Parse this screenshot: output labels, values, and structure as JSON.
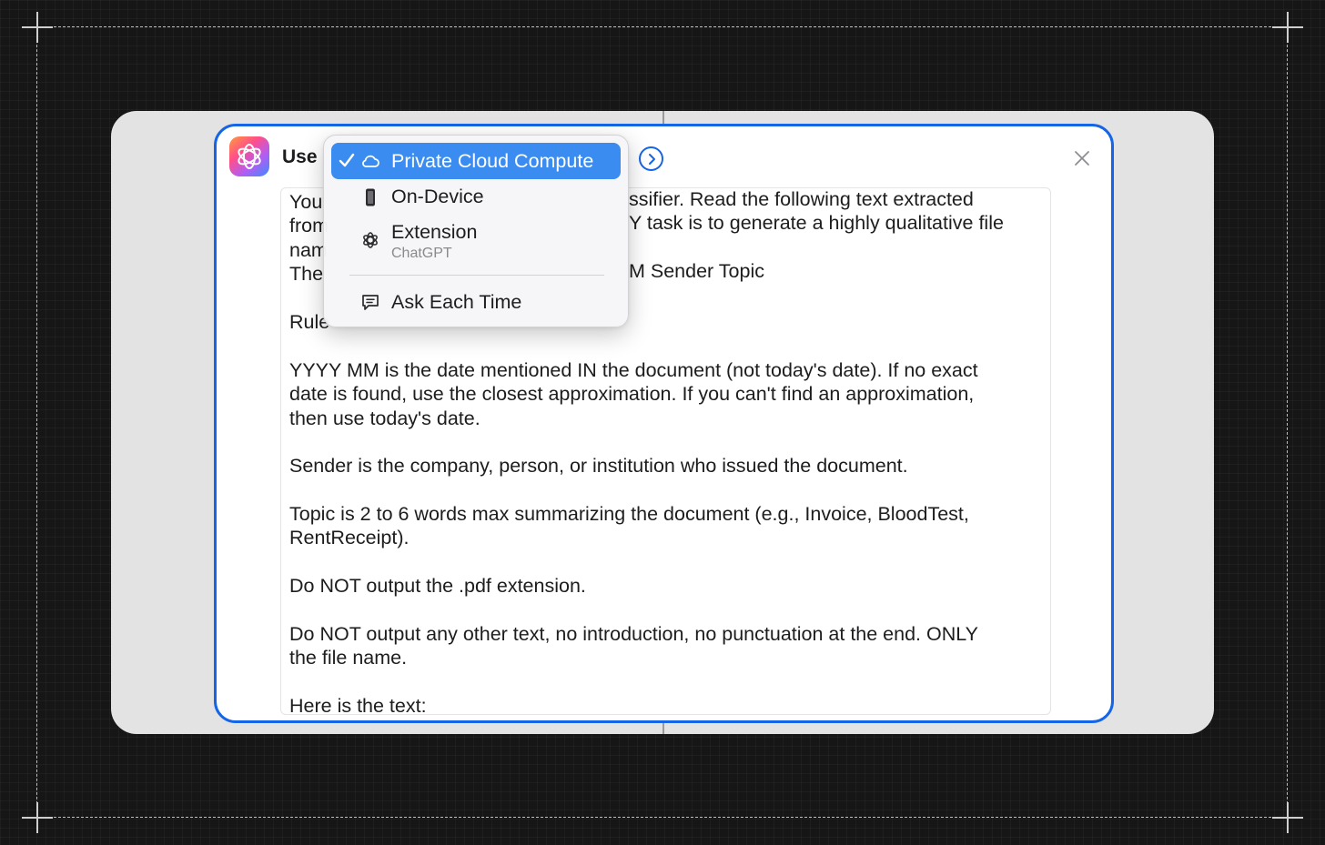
{
  "action": {
    "label": "Use",
    "app_icon": "apple-intelligence-icon"
  },
  "model_menu": {
    "items": [
      {
        "label": "Private Cloud Compute",
        "icon": "cloud-icon",
        "selected": true
      },
      {
        "label": "On-Device",
        "icon": "iphone-icon",
        "selected": false
      },
      {
        "label": "Extension",
        "sublabel": "ChatGPT",
        "icon": "chatgpt-icon",
        "selected": false
      },
      {
        "label": "Ask Each Time",
        "icon": "chat-bubble-icon",
        "selected": false
      }
    ]
  },
  "prompt": {
    "lines": [
      "You",
      "from",
      "nam",
      "The",
      "",
      "Rule",
      "",
      "YYYY MM is the date mentioned IN the document (not today's date). If no exact",
      "date is found, use the closest approximation. If you can't find an approximation,",
      "then use today's date.",
      "",
      "Sender is the company, person, or institution who issued the document.",
      "",
      "Topic is 2 to 6 words max summarizing the document (e.g., Invoice, BloodTest,",
      "RentReceipt).",
      "",
      "Do NOT output the .pdf extension.",
      "",
      "Do NOT output any other text, no introduction, no punctuation at the end. ONLY",
      "the file name.",
      "",
      "Here is the text:"
    ],
    "visible_fragments": [
      "ssifier. Read the following text extracted",
      "Y task is to generate a highly qualitative file",
      "M Sender Topic"
    ]
  },
  "colors": {
    "accent": "#1565e6",
    "menu_selected": "#3a8cf0",
    "canvas": "#e3e3e3",
    "background": "#161616"
  }
}
